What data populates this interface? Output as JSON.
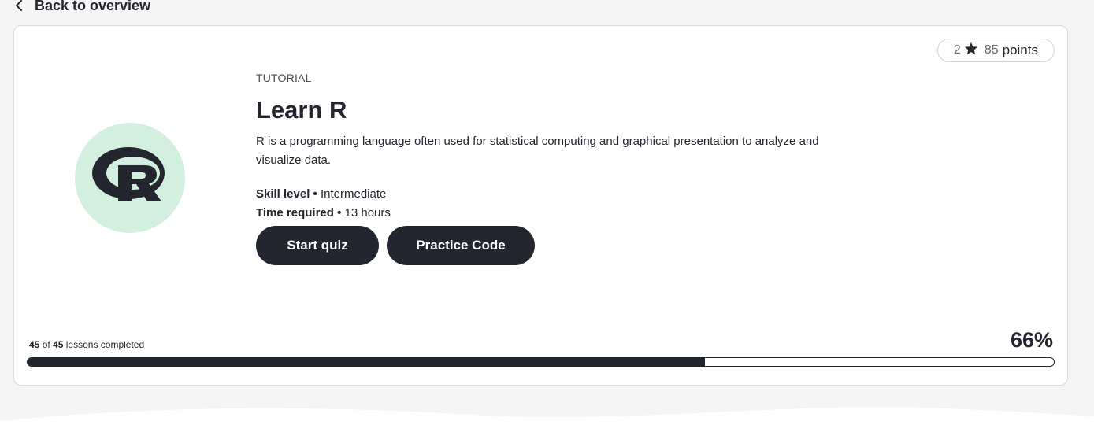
{
  "nav": {
    "back_label": "Back to overview",
    "back_icon": "chevron-left-icon"
  },
  "card": {
    "points": {
      "count": "2",
      "star_icon": "star-icon",
      "value": "85",
      "label": "points"
    },
    "logo_icon": "r-language-logo",
    "logo_bg_color": "#d3efe0",
    "type": "TUTORIAL",
    "title": "Learn R",
    "description": "R is a programming language often used for statistical computing and graphical presentation to analyze and visualize data.",
    "skill_level_label": "Skill level",
    "skill_level_value": "Intermediate",
    "time_required_label": "Time required",
    "time_required_value": "13 hours",
    "buttons": {
      "start_quiz": "Start quiz",
      "practice_code": "Practice Code"
    },
    "progress": {
      "completed": "45",
      "of_text": "of",
      "total": "45",
      "suffix": "lessons completed",
      "percent_label": "66%",
      "fraction": 0.66
    }
  },
  "colors": {
    "primary": "#23262f",
    "accent_bg": "#d3efe0",
    "page_bg": "#f5f5f5"
  }
}
